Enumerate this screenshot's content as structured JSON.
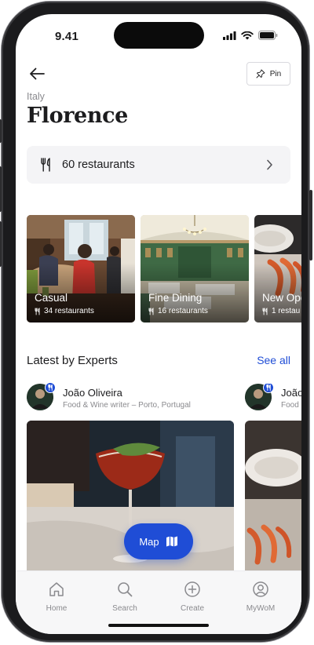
{
  "status_bar": {
    "time": "9.41"
  },
  "header": {
    "pin_label": "Pin",
    "country": "Italy",
    "city": "Florence"
  },
  "restaurants_row": {
    "label": "60 restaurants"
  },
  "categories": [
    {
      "title": "Casual",
      "count": "34 restaurants"
    },
    {
      "title": "Fine Dining",
      "count": "16 restaurants"
    },
    {
      "title": "New Ope",
      "count": "1 restau"
    }
  ],
  "experts_section": {
    "title": "Latest by Experts",
    "see_all": "See all"
  },
  "experts": [
    {
      "name": "João Oliveira",
      "role": "Food & Wine writer – Porto, Portugal"
    },
    {
      "name": "João",
      "role": "Food a"
    }
  ],
  "map_button": {
    "label": "Map"
  },
  "tabbar": {
    "items": [
      {
        "label": "Home",
        "icon": "home-icon"
      },
      {
        "label": "Search",
        "icon": "search-icon"
      },
      {
        "label": "Create",
        "icon": "plus-circle-icon"
      },
      {
        "label": "MyWoM",
        "icon": "profile-icon"
      }
    ]
  },
  "colors": {
    "accent": "#1f4dd6",
    "muted_text": "#8a8a8e"
  }
}
